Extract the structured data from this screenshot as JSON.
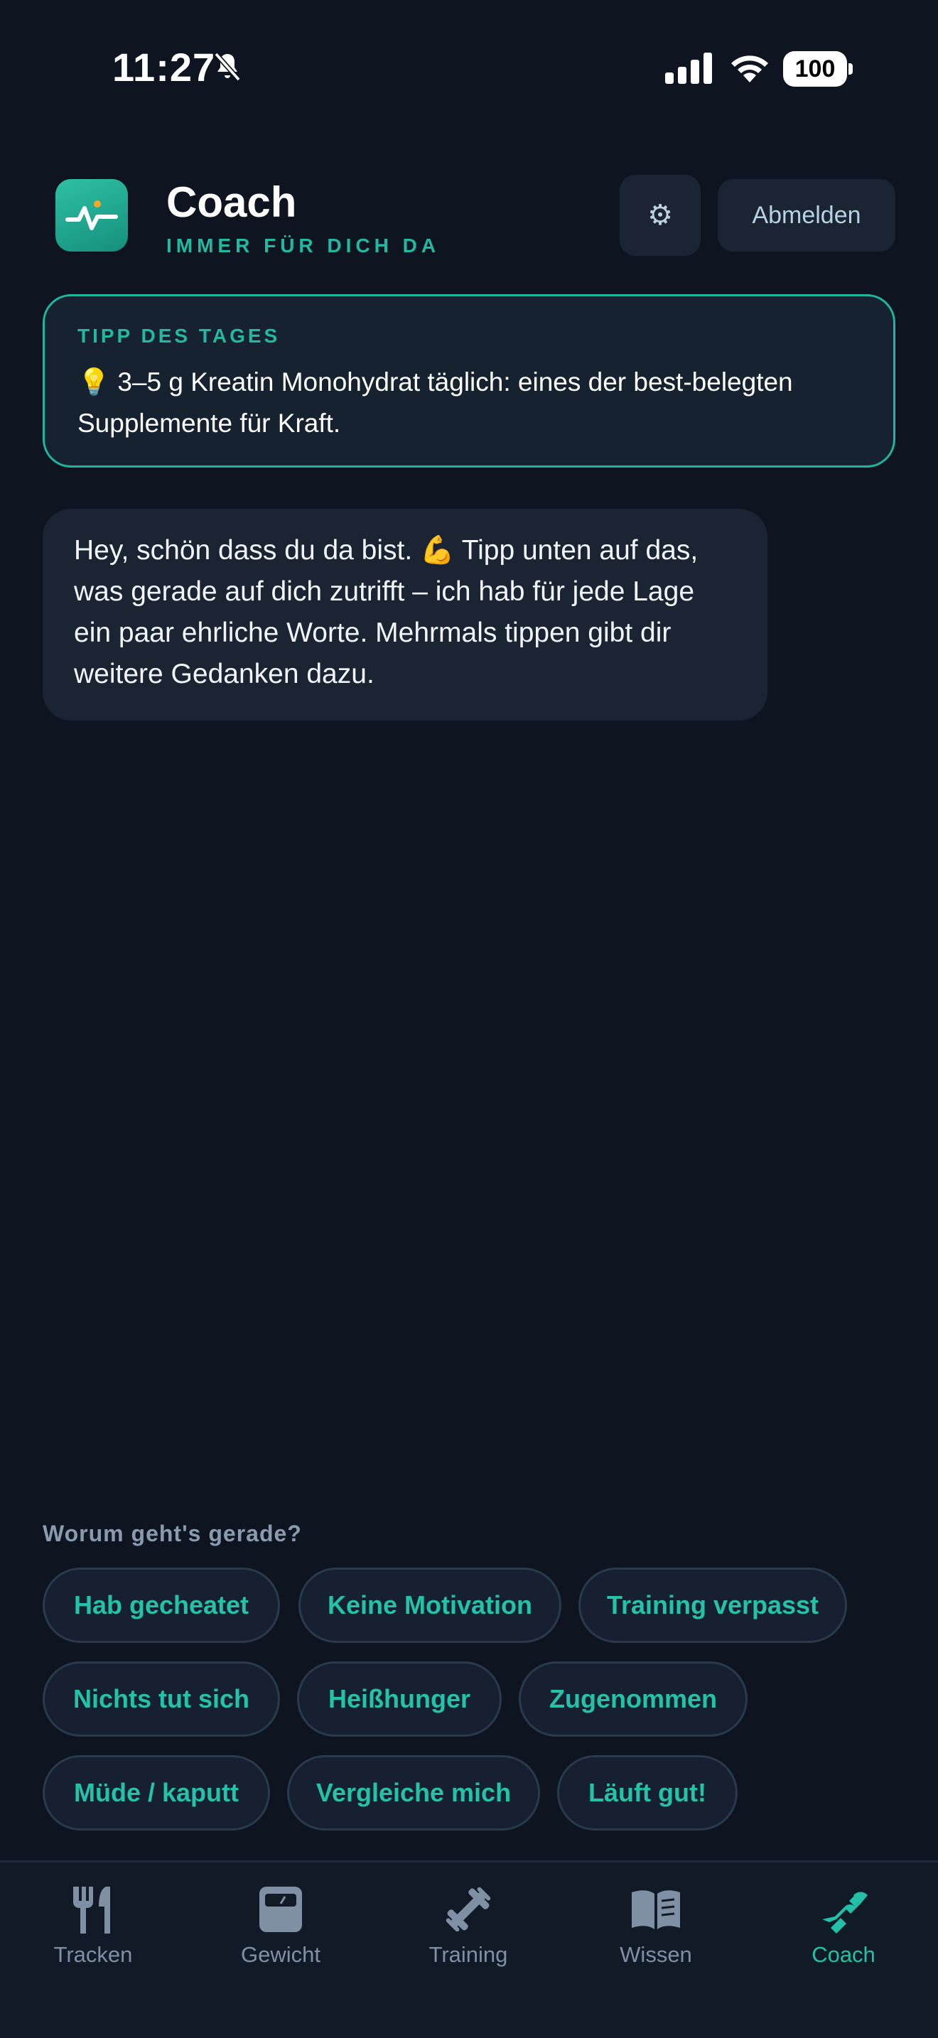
{
  "status_bar": {
    "time": "11:27",
    "battery": "100"
  },
  "header": {
    "title": "Coach",
    "subtitle": "IMMER FÜR DICH DA",
    "settings_icon": "⚙",
    "logout_label": "Abmelden"
  },
  "tip": {
    "label": "TIPP DES TAGES",
    "line1": "💡 3–5 g Kreatin Monohydrat täglich: eines der best-belegten",
    "line2": "Supplemente für Kraft."
  },
  "chat": {
    "lines": [
      "Hey, schön dass du da bist. 💪 Tipp unten auf das,",
      "was gerade auf dich zutrifft – ich hab für jede Lage",
      "ein paar ehrliche Worte. Mehrmals tippen gibt dir",
      "weitere Gedanken dazu."
    ]
  },
  "quick_replies": {
    "prompt": "Worum geht's gerade?",
    "chips": [
      "Hab gecheatet",
      "Keine Motivation",
      "Training verpasst",
      "Nichts tut sich",
      "Heißhunger",
      "Zugenommen",
      "Müde / kaputt",
      "Vergleiche mich",
      "Läuft gut!"
    ]
  },
  "tabs": [
    {
      "label": "Tracken",
      "icon": "fork-knife-icon"
    },
    {
      "label": "Gewicht",
      "icon": "scale-icon"
    },
    {
      "label": "Training",
      "icon": "dumbbell-icon"
    },
    {
      "label": "Wissen",
      "icon": "book-icon"
    },
    {
      "label": "Coach",
      "icon": "coach-icon",
      "active": true
    }
  ],
  "colors": {
    "accent": "#22b9a0",
    "background": "#0e1521",
    "card": "#1a2433",
    "inactive_tab": "#7f90a5"
  }
}
